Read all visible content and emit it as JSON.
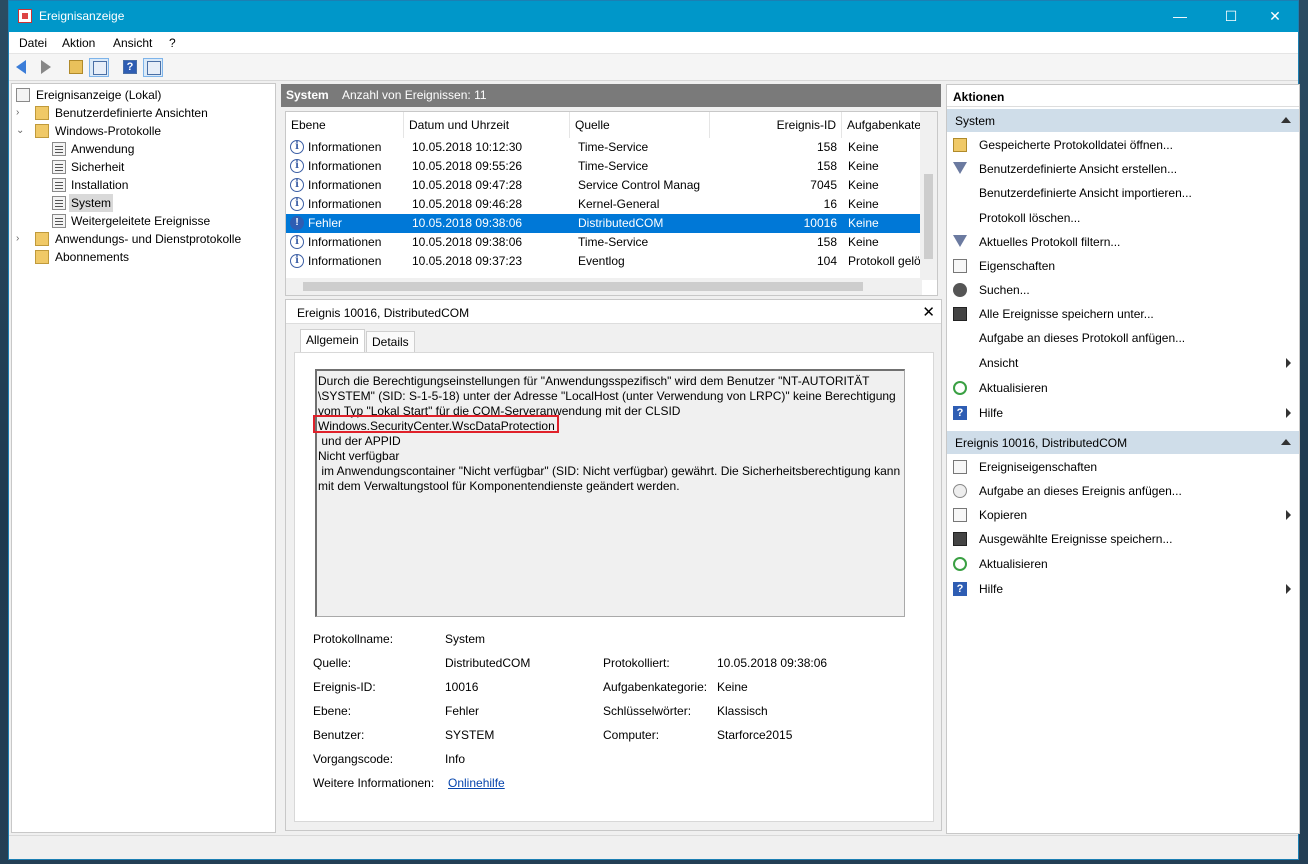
{
  "window": {
    "title": "Ereignisanzeige",
    "minimize": "—",
    "maximize": "☐",
    "close": "✕"
  },
  "menu": [
    "Datei",
    "Aktion",
    "Ansicht",
    "?"
  ],
  "tree": {
    "root": "Ereignisanzeige (Lokal)",
    "custom_views": "Benutzerdefinierte Ansichten",
    "windows_logs": "Windows-Protokolle",
    "logs": [
      "Anwendung",
      "Sicherheit",
      "Installation",
      "System",
      "Weitergeleitete Ereignisse"
    ],
    "app_logs": "Anwendungs- und Dienstprotokolle",
    "subscriptions": "Abonnements"
  },
  "middle": {
    "log_name": "System",
    "event_count": "Anzahl von Ereignissen: 11",
    "columns": [
      "Ebene",
      "Datum und Uhrzeit",
      "Quelle",
      "Ereignis-ID",
      "Aufgabenkate"
    ],
    "rows": [
      {
        "level": "Informationen",
        "date": "10.05.2018 10:12:30",
        "source": "Time-Service",
        "id": "158",
        "task": "Keine",
        "type": "info"
      },
      {
        "level": "Informationen",
        "date": "10.05.2018 09:55:26",
        "source": "Time-Service",
        "id": "158",
        "task": "Keine",
        "type": "info"
      },
      {
        "level": "Informationen",
        "date": "10.05.2018 09:47:28",
        "source": "Service Control Manag",
        "id": "7045",
        "task": "Keine",
        "type": "info"
      },
      {
        "level": "Informationen",
        "date": "10.05.2018 09:46:28",
        "source": "Kernel-General",
        "id": "16",
        "task": "Keine",
        "type": "info"
      },
      {
        "level": "Fehler",
        "date": "10.05.2018 09:38:06",
        "source": "DistributedCOM",
        "id": "10016",
        "task": "Keine",
        "type": "error"
      },
      {
        "level": "Informationen",
        "date": "10.05.2018 09:38:06",
        "source": "Time-Service",
        "id": "158",
        "task": "Keine",
        "type": "info"
      },
      {
        "level": "Informationen",
        "date": "10.05.2018 09:37:23",
        "source": "Eventlog",
        "id": "104",
        "task": "Protokoll gelö",
        "type": "info"
      }
    ]
  },
  "detail": {
    "title": "Ereignis 10016, DistributedCOM",
    "close": "✕",
    "tabs": [
      "Allgemein",
      "Details"
    ],
    "message": "Durch die Berechtigungseinstellungen für \"Anwendungsspezifisch\" wird dem Benutzer \"NT-AUTORITÄT\n\\SYSTEM\" (SID: S-1-5-18) unter der Adresse \"LocalHost (unter Verwendung von LRPC)\" keine Berechtigung\nvom Typ \"Lokal Start\" für die COM-Serveranwendung mit der CLSID\nWindows.SecurityCenter.WscDataProtection\n und der APPID\nNicht verfügbar\n im Anwendungscontainer \"Nicht verfügbar\" (SID: Nicht verfügbar) gewährt. Die Sicherheitsberechtigung kann\nmit dem Verwaltungstool für Komponentendienste geändert werden.",
    "props": {
      "protokollname_label": "Protokollname:",
      "protokollname": "System",
      "quelle_label": "Quelle:",
      "quelle": "DistributedCOM",
      "protokolliert_label": "Protokolliert:",
      "protokolliert": "10.05.2018 09:38:06",
      "id_label": "Ereignis-ID:",
      "id": "10016",
      "kategorie_label": "Aufgabenkategorie:",
      "kategorie": "Keine",
      "ebene_label": "Ebene:",
      "ebene": "Fehler",
      "schluessel_label": "Schlüsselwörter:",
      "schluessel": "Klassisch",
      "benutzer_label": "Benutzer:",
      "benutzer": "SYSTEM",
      "computer_label": "Computer:",
      "computer": "Starforce2015",
      "vorgang_label": "Vorgangscode:",
      "vorgang": "Info",
      "info_label": "Weitere Informationen:",
      "info_link": "Onlinehilfe"
    }
  },
  "actions": {
    "header": "Aktionen",
    "section1": "System",
    "items1": [
      "Gespeicherte Protokolldatei öffnen...",
      "Benutzerdefinierte Ansicht erstellen...",
      "Benutzerdefinierte Ansicht importieren...",
      "Protokoll löschen...",
      "Aktuelles Protokoll filtern...",
      "Eigenschaften",
      "Suchen...",
      "Alle Ereignisse speichern unter...",
      "Aufgabe an dieses Protokoll anfügen...",
      "Ansicht",
      "Aktualisieren",
      "Hilfe"
    ],
    "section2": "Ereignis 10016, DistributedCOM",
    "items2": [
      "Ereigniseigenschaften",
      "Aufgabe an dieses Ereignis anfügen...",
      "Kopieren",
      "Ausgewählte Ereignisse speichern...",
      "Aktualisieren",
      "Hilfe"
    ]
  },
  "colors": {
    "titlebar": "#0097c9",
    "selection": "#0078d7",
    "highlight_box": "#e0212a",
    "section_header": "#cfdde9"
  }
}
